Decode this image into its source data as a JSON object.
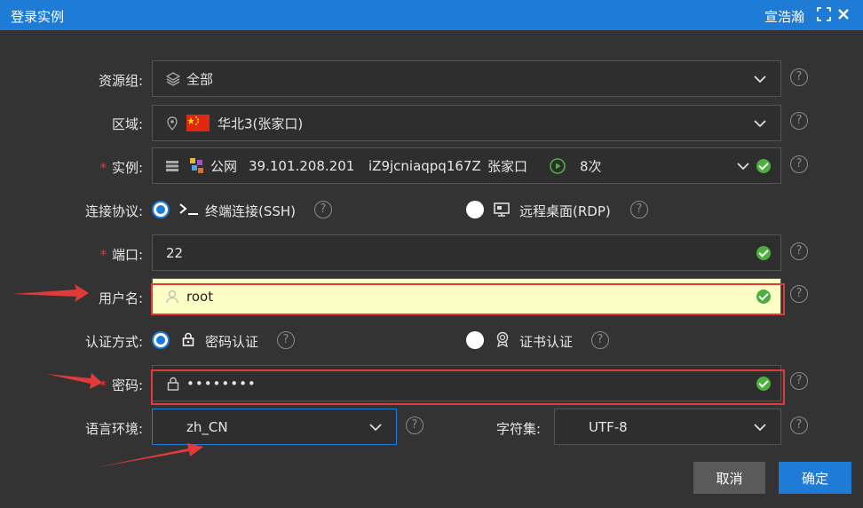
{
  "window": {
    "title": "登录实例",
    "user": "宣浩瀚"
  },
  "form": {
    "resource_group": {
      "label": "资源组:",
      "value": "全部"
    },
    "region": {
      "label": "区域:",
      "value": "华北3(张家口)"
    },
    "instance": {
      "required_mark": "*",
      "label": "实例:",
      "network": "公网",
      "ip": "39.101.208.201",
      "instance_id": "iZ9jcniaqpq167Z",
      "zone": "张家口",
      "count": "8次"
    },
    "protocol": {
      "label": "连接协议:",
      "options": [
        {
          "label": "终端连接(SSH)",
          "selected": true
        },
        {
          "label": "远程桌面(RDP)",
          "selected": false
        }
      ]
    },
    "port": {
      "required_mark": "*",
      "label": "端口:",
      "value": "22"
    },
    "username": {
      "label": "用户名:",
      "value": "root"
    },
    "auth_method": {
      "label": "认证方式:",
      "options": [
        {
          "label": "密码认证",
          "selected": true
        },
        {
          "label": "证书认证",
          "selected": false
        }
      ]
    },
    "password": {
      "required_mark": "*",
      "label": "密码:",
      "value": "••••••••"
    },
    "locale": {
      "label": "语言环境:",
      "value": "zh_CN"
    },
    "charset": {
      "label": "字符集:",
      "value": "UTF-8"
    },
    "help_glyph": "?"
  },
  "buttons": {
    "cancel": "取消",
    "confirm": "确定"
  },
  "colors": {
    "titlebar": "#1e7bd6",
    "background": "#333333",
    "success": "#4caf3e",
    "annotation": "#e23a3a",
    "highlight": "#fdfdc6"
  }
}
